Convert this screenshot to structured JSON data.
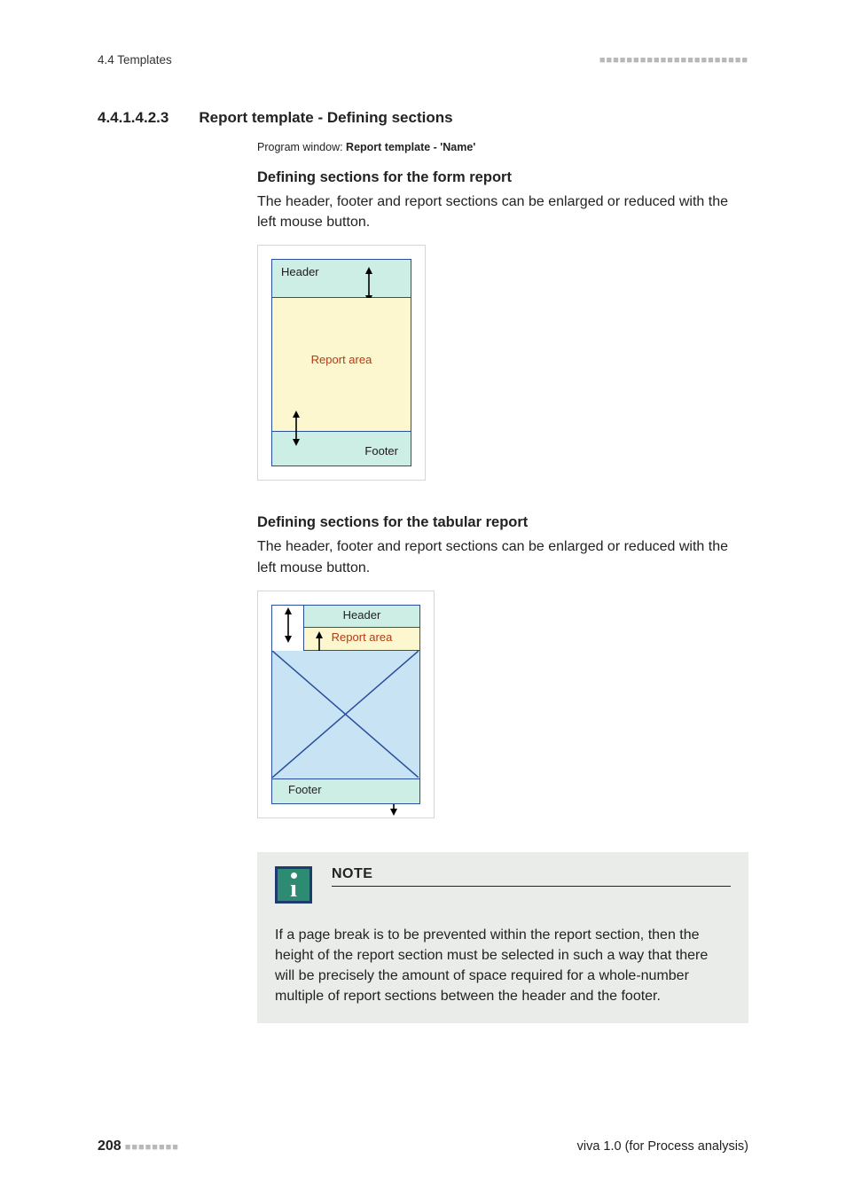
{
  "header": {
    "left": "4.4 Templates",
    "dots_long": "■■■■■■■■■■■■■■■■■■■■■■"
  },
  "section": {
    "number": "4.4.1.4.2.3",
    "title": "Report template - Defining sections",
    "program_prefix": "Program window: ",
    "program_bold": "Report template - 'Name'"
  },
  "sub_form": {
    "heading": "Defining sections for the form report",
    "body": "The header, footer and report sections can be enlarged or reduced with the left mouse button.",
    "diagram": {
      "header_label": "Header",
      "area_label": "Report area",
      "footer_label": "Footer"
    }
  },
  "sub_tab": {
    "heading": "Defining sections for the tabular report",
    "body": "The header, footer and report sections can be enlarged or reduced with the left mouse button.",
    "diagram": {
      "header_label": "Header",
      "area_label": "Report area",
      "footer_label": "Footer"
    }
  },
  "note": {
    "title": "NOTE",
    "body": "If a page break is to be prevented within the report section, then the height of the report section must be selected in such a way that there will be precisely the amount of space required for a whole-number multiple of report sections between the header and the footer."
  },
  "footer": {
    "page": "208",
    "dots_short": "■■■■■■■■",
    "right": "viva 1.0 (for Process analysis)"
  }
}
